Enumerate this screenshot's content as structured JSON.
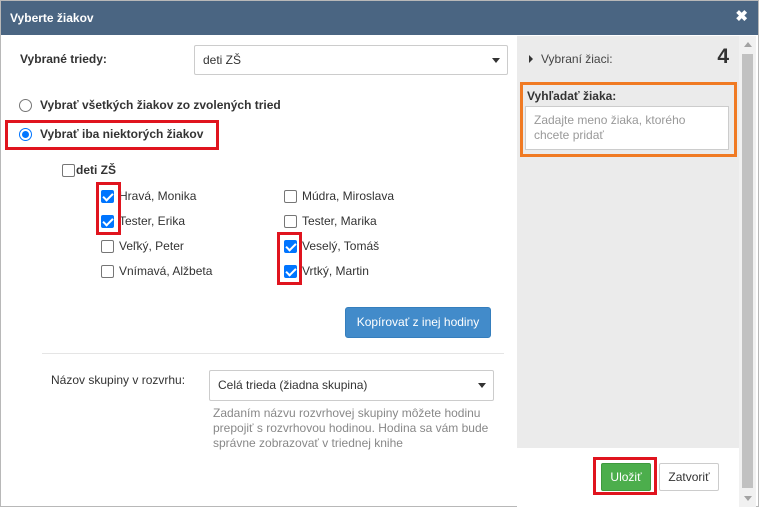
{
  "dialog": {
    "title": "Vyberte žiakov",
    "close_symbol": "✖"
  },
  "classes": {
    "label": "Vybrané triedy:",
    "selected": "deti ZŠ"
  },
  "radios": {
    "all_label": "Vybrať všetkých žiakov zo zvolených tried",
    "some_label": "Vybrať iba niektorých žiakov",
    "selected": "some"
  },
  "group": {
    "label": "deti ZŠ",
    "checked": false
  },
  "students_left": [
    {
      "name": "Hravá, Monika",
      "checked": true
    },
    {
      "name": "Tester, Erika",
      "checked": true
    },
    {
      "name": "Veľký, Peter",
      "checked": false
    },
    {
      "name": "Vnímavá, Alžbeta",
      "checked": false
    }
  ],
  "students_right": [
    {
      "name": "Múdra, Miroslava",
      "checked": false
    },
    {
      "name": "Tester, Marika",
      "checked": false
    },
    {
      "name": "Veselý, Tomáš",
      "checked": true
    },
    {
      "name": "Vrtký, Martin",
      "checked": true
    }
  ],
  "copy_button": "Kopírovať z inej hodiny",
  "schedule_group": {
    "label": "Názov skupiny v rozvrhu:",
    "selected": "Celá trieda (žiadna skupina)",
    "help": "Zadaním názvu rozvrhovej skupiny môžete hodinu prepojiť s rozvrhovou hodinou. Hodina sa vám bude správne zobrazovať v triednej knihe"
  },
  "right_panel": {
    "selected_label": "Vybraní žiaci:",
    "selected_count": "4",
    "search_label": "Vyhľadať žiaka:",
    "search_placeholder": "Zadajte meno žiaka, ktorého chcete pridať"
  },
  "footer": {
    "save_label": "Uložiť",
    "close_label": "Zatvoriť"
  },
  "colors": {
    "titlebar": "#4a6582",
    "highlight_red": "#e0141e",
    "highlight_orange": "#f07a23",
    "primary_blue": "#428bca",
    "success_green": "#4cae4c"
  }
}
